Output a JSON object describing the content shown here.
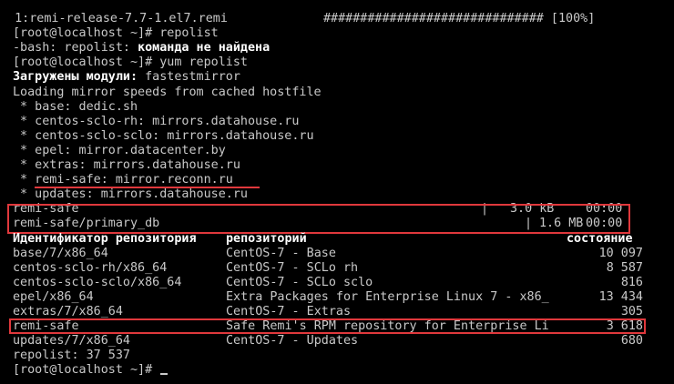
{
  "terminal": {
    "progress": {
      "package": "  1:remi-release-7.7-1.el7.remi",
      "bar": "############################## [100%]",
      "percent": 100
    },
    "lines": {
      "cmd_repolist": "[root@localhost ~]# repolist",
      "err_prefix": "-bash: repolist: ",
      "err_msg": "команда не найдена",
      "cmd_yum": "[root@localhost ~]# yum repolist",
      "plugins_label": "Загружены модули: ",
      "plugins_value": "fastestmirror",
      "loading": "Loading mirror speeds from cached hostfile"
    },
    "mirrors": [
      " * base: dedic.sh",
      " * centos-sclo-rh: mirrors.datahouse.ru",
      " * centos-sclo-sclo: mirrors.datahouse.ru",
      " * epel: mirror.datacenter.by",
      " * extras: mirrors.datahouse.ru",
      " * remi-safe: mirror.reconn.ru",
      " * updates: mirrors.datahouse.ru"
    ],
    "downloads": [
      {
        "name": "remi-safe",
        "sep": "|",
        "size": "3.0 kB",
        "time": "00:00"
      },
      {
        "name": "remi-safe/primary_db",
        "sep": "|",
        "size": "1.6 MB",
        "time": "00:00"
      }
    ],
    "table": {
      "headers": {
        "id": "Идентификатор репозитория",
        "name": "репозиторий",
        "status": "состояние"
      },
      "rows": [
        {
          "id": "base/7/x86_64",
          "name": "CentOS-7 - Base",
          "status": "10 097"
        },
        {
          "id": "centos-sclo-rh/x86_64",
          "name": "CentOS-7 - SCLo rh",
          "status": "8 587"
        },
        {
          "id": "centos-sclo-sclo/x86_64",
          "name": "CentOS-7 - SCLo sclo",
          "status": "816"
        },
        {
          "id": "epel/x86_64",
          "name": "Extra Packages for Enterprise Linux 7 - x86_",
          "status": "13 434"
        },
        {
          "id": "extras/7/x86_64",
          "name": "CentOS-7 - Extras",
          "status": "305"
        },
        {
          "id": "remi-safe",
          "name": "Safe Remi's RPM repository for Enterprise Li",
          "status": "3 618"
        },
        {
          "id": "updates/7/x86_64",
          "name": "CentOS-7 - Updates",
          "status": "680"
        }
      ]
    },
    "summary": "repolist: 37 537",
    "prompt": "[root@localhost ~]# "
  },
  "colors": {
    "highlight": "#e0383c",
    "text": "#c9c9c9",
    "bold": "#ffffff",
    "background": "#000000"
  }
}
